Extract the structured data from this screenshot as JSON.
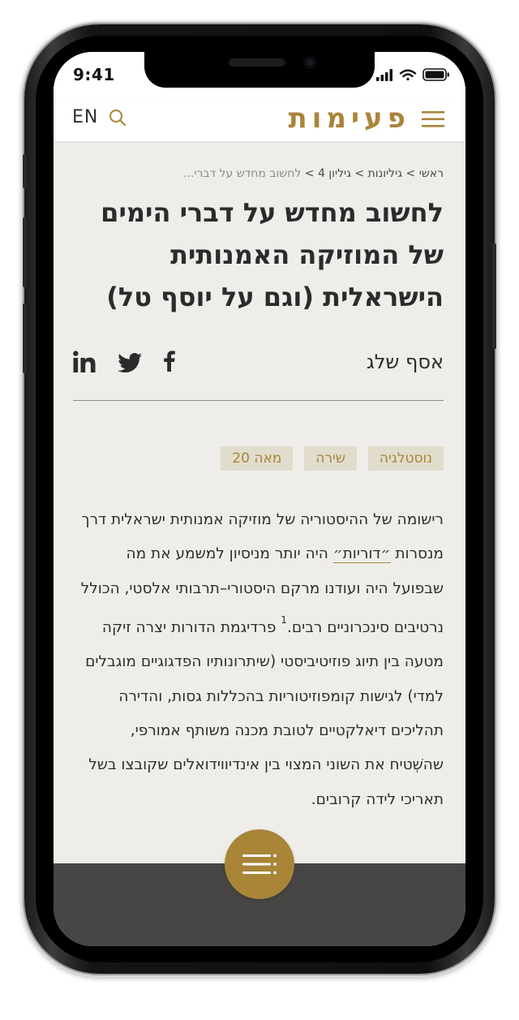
{
  "status_bar": {
    "time": "9:41"
  },
  "header": {
    "lang": "EN",
    "logo": "פעימות",
    "icons": [
      "search-icon",
      "menu-icon"
    ]
  },
  "breadcrumb": {
    "home": "ראשי",
    "separator": ">",
    "issues": "גיליונות",
    "issue": "גיליון 4",
    "current": "לחשוב מחדש על דברי..."
  },
  "article": {
    "title": "לחשוב מחדש על דברי הימים של המוזיקה האמנותית הישראלית (וגם על יוסף טל)",
    "author": "אסף שלג",
    "social": [
      "facebook-icon",
      "twitter-icon",
      "linkedin-icon"
    ],
    "tags": [
      "נוסטלגיה",
      "שירה",
      "מאה 20"
    ],
    "body_part1": "רישומה של ההיסטוריה של מוזיקה אמנותית ישראלית דרך מנסרות ",
    "body_link": "״דוריות״",
    "body_part2": " היה יותר מניסיון למשמע את מה שבפועל היה ועודנו מרקם היסטורי–תרבותי אלסטי, הכולל נרטיבים סינכרוניים רבים.",
    "footnote": "1",
    "body_part3": " פרדיגמת הדורות יצרה זיקה מטעה בין תיוג פוזיטיביסטי (שיתרונותיו הפדגוגיים מוגבלים למדי) לגישות קומפוזיטוריות בהכללות גסות, והדירה תהליכים דיאלקטיים לטובת מכנה משותף אמורפי, שהשְׁטיח את השוני המצוי בין אינדיווידואלים שקובצו בשל תאריכי לידה קרובים."
  },
  "colors": {
    "accent": "#a88537",
    "background": "#efedea",
    "text": "#2b2b2b",
    "tag_bg": "#e2dccd",
    "bottom_bar": "#474645"
  },
  "fab": {
    "icon": "table-of-contents-icon"
  }
}
